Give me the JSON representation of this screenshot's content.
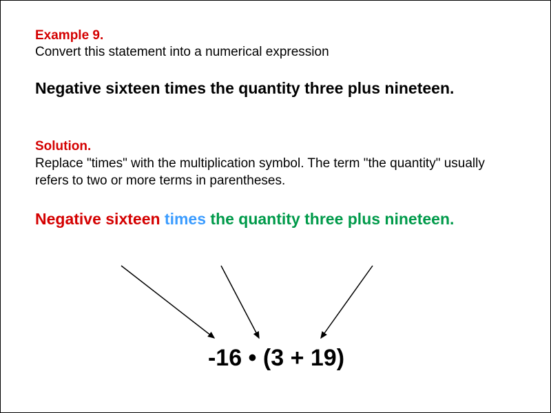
{
  "example": {
    "label": "Example 9.",
    "instruction": "Convert this statement into a numerical expression",
    "problem": "Negative sixteen times the quantity three plus nineteen."
  },
  "solution": {
    "label": "Solution.",
    "text": "Replace \"times\" with the multiplication symbol. The term \"the quantity\" usually refers to two or more terms in parentheses.",
    "colored": {
      "red": "Negative sixteen ",
      "blue": "times ",
      "green": "the quantity three plus nineteen."
    },
    "expression": "-16 • (3 + 19)"
  }
}
